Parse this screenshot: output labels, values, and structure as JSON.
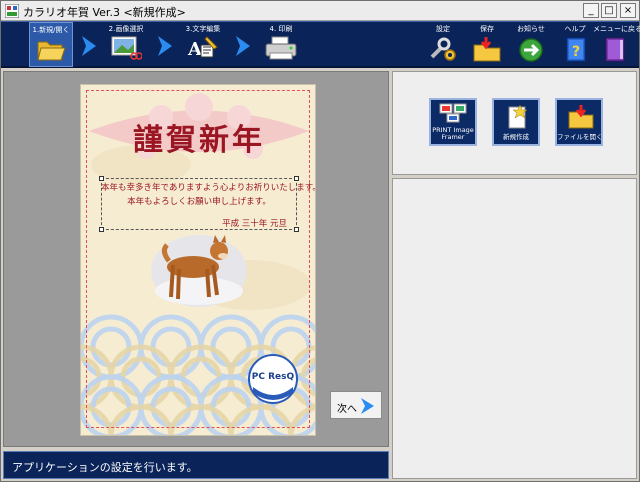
{
  "window": {
    "title": "カラリオ年賀 Ver.3 <新規作成>",
    "controls": [
      "_",
      "□",
      "×"
    ]
  },
  "toolbar": {
    "steps": [
      {
        "label": "1.新規/開く",
        "icon": "folder-open-icon"
      },
      {
        "label": "2.画像選択",
        "icon": "image-select-icon"
      },
      {
        "label": "3.文字編集",
        "icon": "text-edit-icon"
      },
      {
        "label": "4. 印刷",
        "icon": "printer-icon"
      }
    ],
    "tools": [
      {
        "label": "設定",
        "icon": "settings-icon"
      },
      {
        "label": "保存",
        "icon": "save-icon"
      },
      {
        "label": "お知らせ",
        "icon": "news-icon"
      },
      {
        "label": "ヘルプ",
        "icon": "help-icon"
      },
      {
        "label": "メニューに戻る",
        "icon": "menu-return-icon"
      }
    ]
  },
  "card": {
    "title": "謹賀新年",
    "greeting_line1": "本年も幸多き年でありますよう心よりお祈りいたします。",
    "greeting_line2": "本年もよろしくお願い申し上げます。",
    "date": "平成 三十年  元旦",
    "logo_text": "PC ResQ"
  },
  "next_button": {
    "label": "次へ"
  },
  "status": {
    "text": "アプリケーションの設定を行います。"
  },
  "right_panel": {
    "buttons": [
      {
        "label": "PRINT Image Framer",
        "icon": "print-image-framer-icon"
      },
      {
        "label": "新規作成",
        "icon": "new-document-icon"
      },
      {
        "label": "ファイルを開く",
        "icon": "open-file-icon"
      }
    ]
  },
  "colors": {
    "toolbar_bg": "#0a2358",
    "accent_red": "#9b1623",
    "arrow_blue": "#2a8cf0"
  }
}
